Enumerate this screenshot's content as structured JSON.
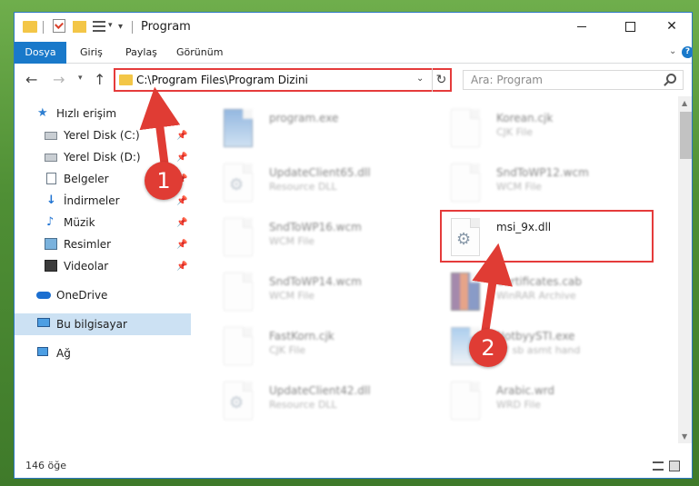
{
  "window": {
    "title": "Program",
    "minimize": "",
    "maximize": "",
    "close": "✕"
  },
  "ribbon": {
    "tabs": [
      "Dosya",
      "Giriş",
      "Paylaş",
      "Görünüm"
    ],
    "help": "?"
  },
  "address": {
    "path": "C:\\Program Files\\Program Dizini",
    "search_placeholder": "Ara: Program"
  },
  "sidebar": {
    "items": [
      {
        "label": "Hızlı erişim",
        "icon": "star-icon"
      },
      {
        "label": "Yerel Disk (C:)",
        "icon": "drive-icon",
        "pinned": true
      },
      {
        "label": "Yerel Disk (D:)",
        "icon": "drive-icon",
        "pinned": true
      },
      {
        "label": "Belgeler",
        "icon": "document-icon",
        "pinned": true
      },
      {
        "label": "İndirmeler",
        "icon": "download-icon",
        "pinned": true
      },
      {
        "label": "Müzik",
        "icon": "music-icon",
        "pinned": true
      },
      {
        "label": "Resimler",
        "icon": "pictures-icon",
        "pinned": true
      },
      {
        "label": "Videolar",
        "icon": "videos-icon",
        "pinned": true
      },
      {
        "label": "OneDrive",
        "icon": "cloud-icon"
      },
      {
        "label": "Bu bilgisayar",
        "icon": "computer-icon",
        "selected": true
      },
      {
        "label": "Ağ",
        "icon": "network-icon"
      }
    ]
  },
  "files": [
    {
      "name": "program.exe",
      "type": "",
      "icon": "exe-icon"
    },
    {
      "name": "Korean.cjk",
      "type": "CJK File",
      "icon": "file-icon"
    },
    {
      "name": "UpdateClient65.dll",
      "type": "Resource DLL",
      "icon": "dll-icon"
    },
    {
      "name": "SndToWP12.wcm",
      "type": "WCM File",
      "icon": "file-icon"
    },
    {
      "name": "SndToWP16.wcm",
      "type": "WCM File",
      "icon": "file-icon"
    },
    {
      "name": "msi_9x.dll",
      "type": "",
      "icon": "dll-icon"
    },
    {
      "name": "SndToWP14.wcm",
      "type": "WCM File",
      "icon": "file-icon"
    },
    {
      "name": "Certificates.cab",
      "type": "WinRAR Archive",
      "icon": "archive-icon"
    },
    {
      "name": "FastKorn.cjk",
      "type": "CJK File",
      "icon": "file-icon"
    },
    {
      "name": "NotbyySTI.exe",
      "type": "97 sb asmt hand",
      "icon": "exe-icon"
    },
    {
      "name": "UpdateClient42.dll",
      "type": "Resource DLL",
      "icon": "dll-icon"
    },
    {
      "name": "Arabic.wrd",
      "type": "WRD File",
      "icon": "file-icon"
    }
  ],
  "status": {
    "count": "146 öğe"
  },
  "annotations": {
    "step1": "1",
    "step2": "2",
    "color": "#e03c34"
  }
}
